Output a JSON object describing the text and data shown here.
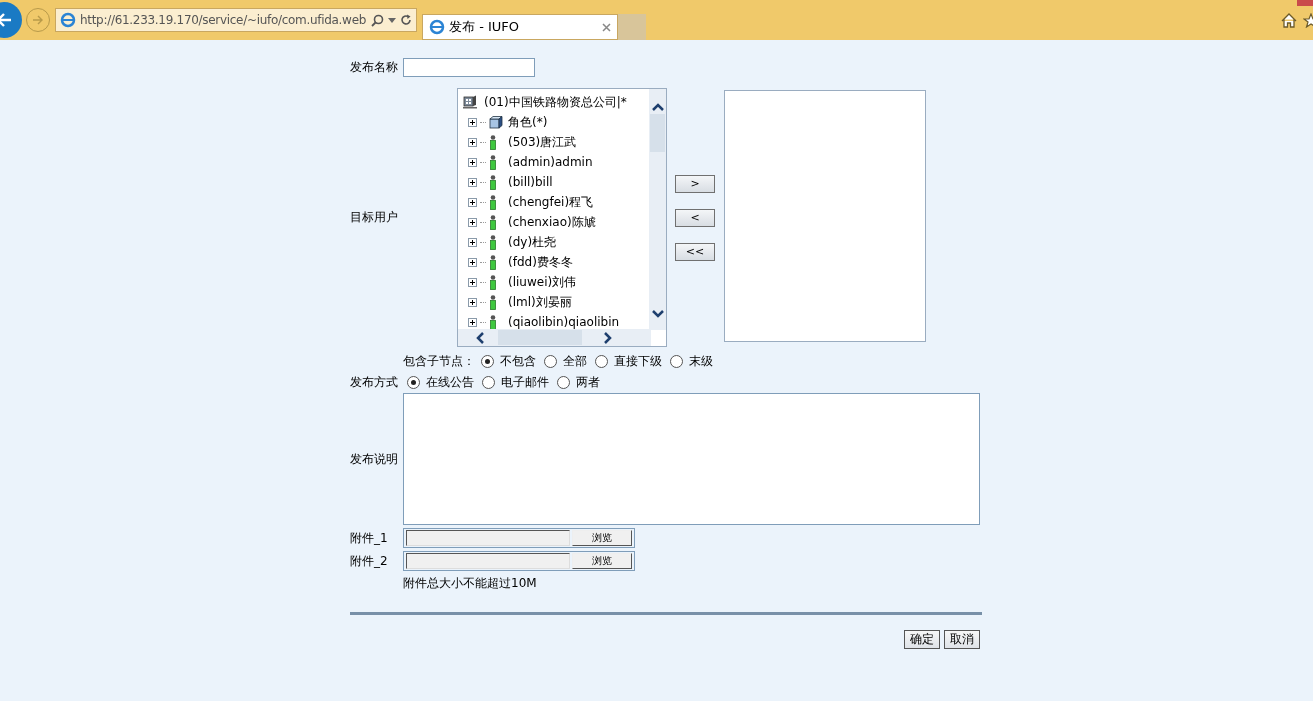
{
  "browser": {
    "address": "http://61.233.19.170/service/~iufo/com.ufida.web",
    "tab_title": "发布 - IUFO"
  },
  "form": {
    "name_label": "发布名称",
    "target_label": "目标用户",
    "tree": {
      "label": "(01)中国铁路物资总公司|*",
      "children": [
        {
          "label": "角色(*)",
          "kind": "role",
          "expanded": false
        },
        {
          "label": "(503)唐江武",
          "kind": "user",
          "expanded": false
        },
        {
          "label": "(admin)admin",
          "kind": "user",
          "expanded": false
        },
        {
          "label": "(bill)bill",
          "kind": "user",
          "expanded": false
        },
        {
          "label": "(chengfei)程飞",
          "kind": "user",
          "expanded": false
        },
        {
          "label": "(chenxiao)陈虓",
          "kind": "user",
          "expanded": false
        },
        {
          "label": "(dy)杜尧",
          "kind": "user",
          "expanded": false
        },
        {
          "label": "(fdd)费冬冬",
          "kind": "user",
          "expanded": false
        },
        {
          "label": "(liuwei)刘伟",
          "kind": "user",
          "expanded": false
        },
        {
          "label": "(lml)刘晏丽",
          "kind": "user",
          "expanded": false
        },
        {
          "label": "(qiaolibin)qiaolibin",
          "kind": "user",
          "expanded": false
        }
      ]
    },
    "move_buttons": [
      ">",
      "<",
      "<<"
    ],
    "include_label": "包含子节点：",
    "include_options": [
      {
        "label": "不包含",
        "selected": true
      },
      {
        "label": "全部",
        "selected": false
      },
      {
        "label": "直接下级",
        "selected": false
      },
      {
        "label": "末级",
        "selected": false
      }
    ],
    "method_label": "发布方式",
    "method_options": [
      {
        "label": "在线公告",
        "selected": true
      },
      {
        "label": "电子邮件",
        "selected": false
      },
      {
        "label": "两者",
        "selected": false
      }
    ],
    "description_label": "发布说明",
    "attachments": [
      {
        "label": "附件_1",
        "button": "浏览"
      },
      {
        "label": "附件_2",
        "button": "浏览"
      }
    ],
    "attachment_note": "附件总大小不能超过10M",
    "actions": [
      "确定",
      "取消"
    ]
  }
}
